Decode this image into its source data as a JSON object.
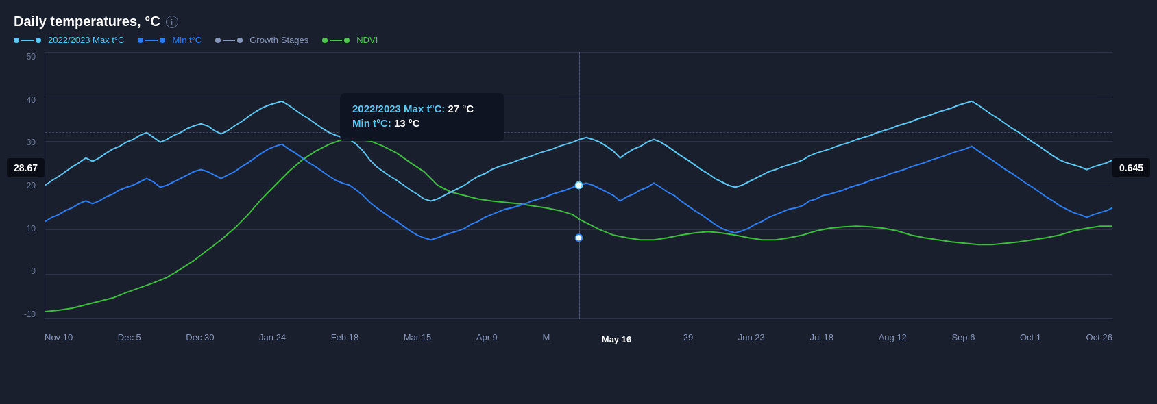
{
  "title": "Daily temperatures, °C",
  "legend": {
    "items": [
      {
        "label": "2022/2023 Max t°C",
        "color": "#5bc8f5",
        "type": "line-dot"
      },
      {
        "label": "Min t°C",
        "color": "#2d7ef7",
        "type": "line-dot"
      },
      {
        "label": "Growth Stages",
        "color": "#8899bb",
        "type": "line-dot"
      },
      {
        "label": "NDVI",
        "color": "#4dc94d",
        "type": "line-dot"
      }
    ]
  },
  "yAxis": {
    "labels": [
      "50",
      "40",
      "30",
      "20",
      "10",
      "0",
      "-10"
    ]
  },
  "xAxis": {
    "labels": [
      "Nov 10",
      "Dec 5",
      "Dec 30",
      "Jan 24",
      "Feb 18",
      "Mar 15",
      "Apr 9",
      "M",
      "May 16",
      "29",
      "Jun 23",
      "Jul 18",
      "Aug 12",
      "Sep 6",
      "Oct 1",
      "Oct 26"
    ]
  },
  "tooltip": {
    "max_label": "2022/2023 Max t°C:",
    "max_value": "27 °C",
    "min_label": "Min t°C:",
    "min_value": "13 °C"
  },
  "badges": {
    "left": "28.67",
    "right": "0.645"
  },
  "active_date": "May 16",
  "info_icon": "i",
  "colors": {
    "max_line": "#5bc8f5",
    "min_line": "#2d7ef7",
    "ndvi_line": "#3dbf3d",
    "grid": "#2d3348",
    "background": "#1a1f2e"
  }
}
